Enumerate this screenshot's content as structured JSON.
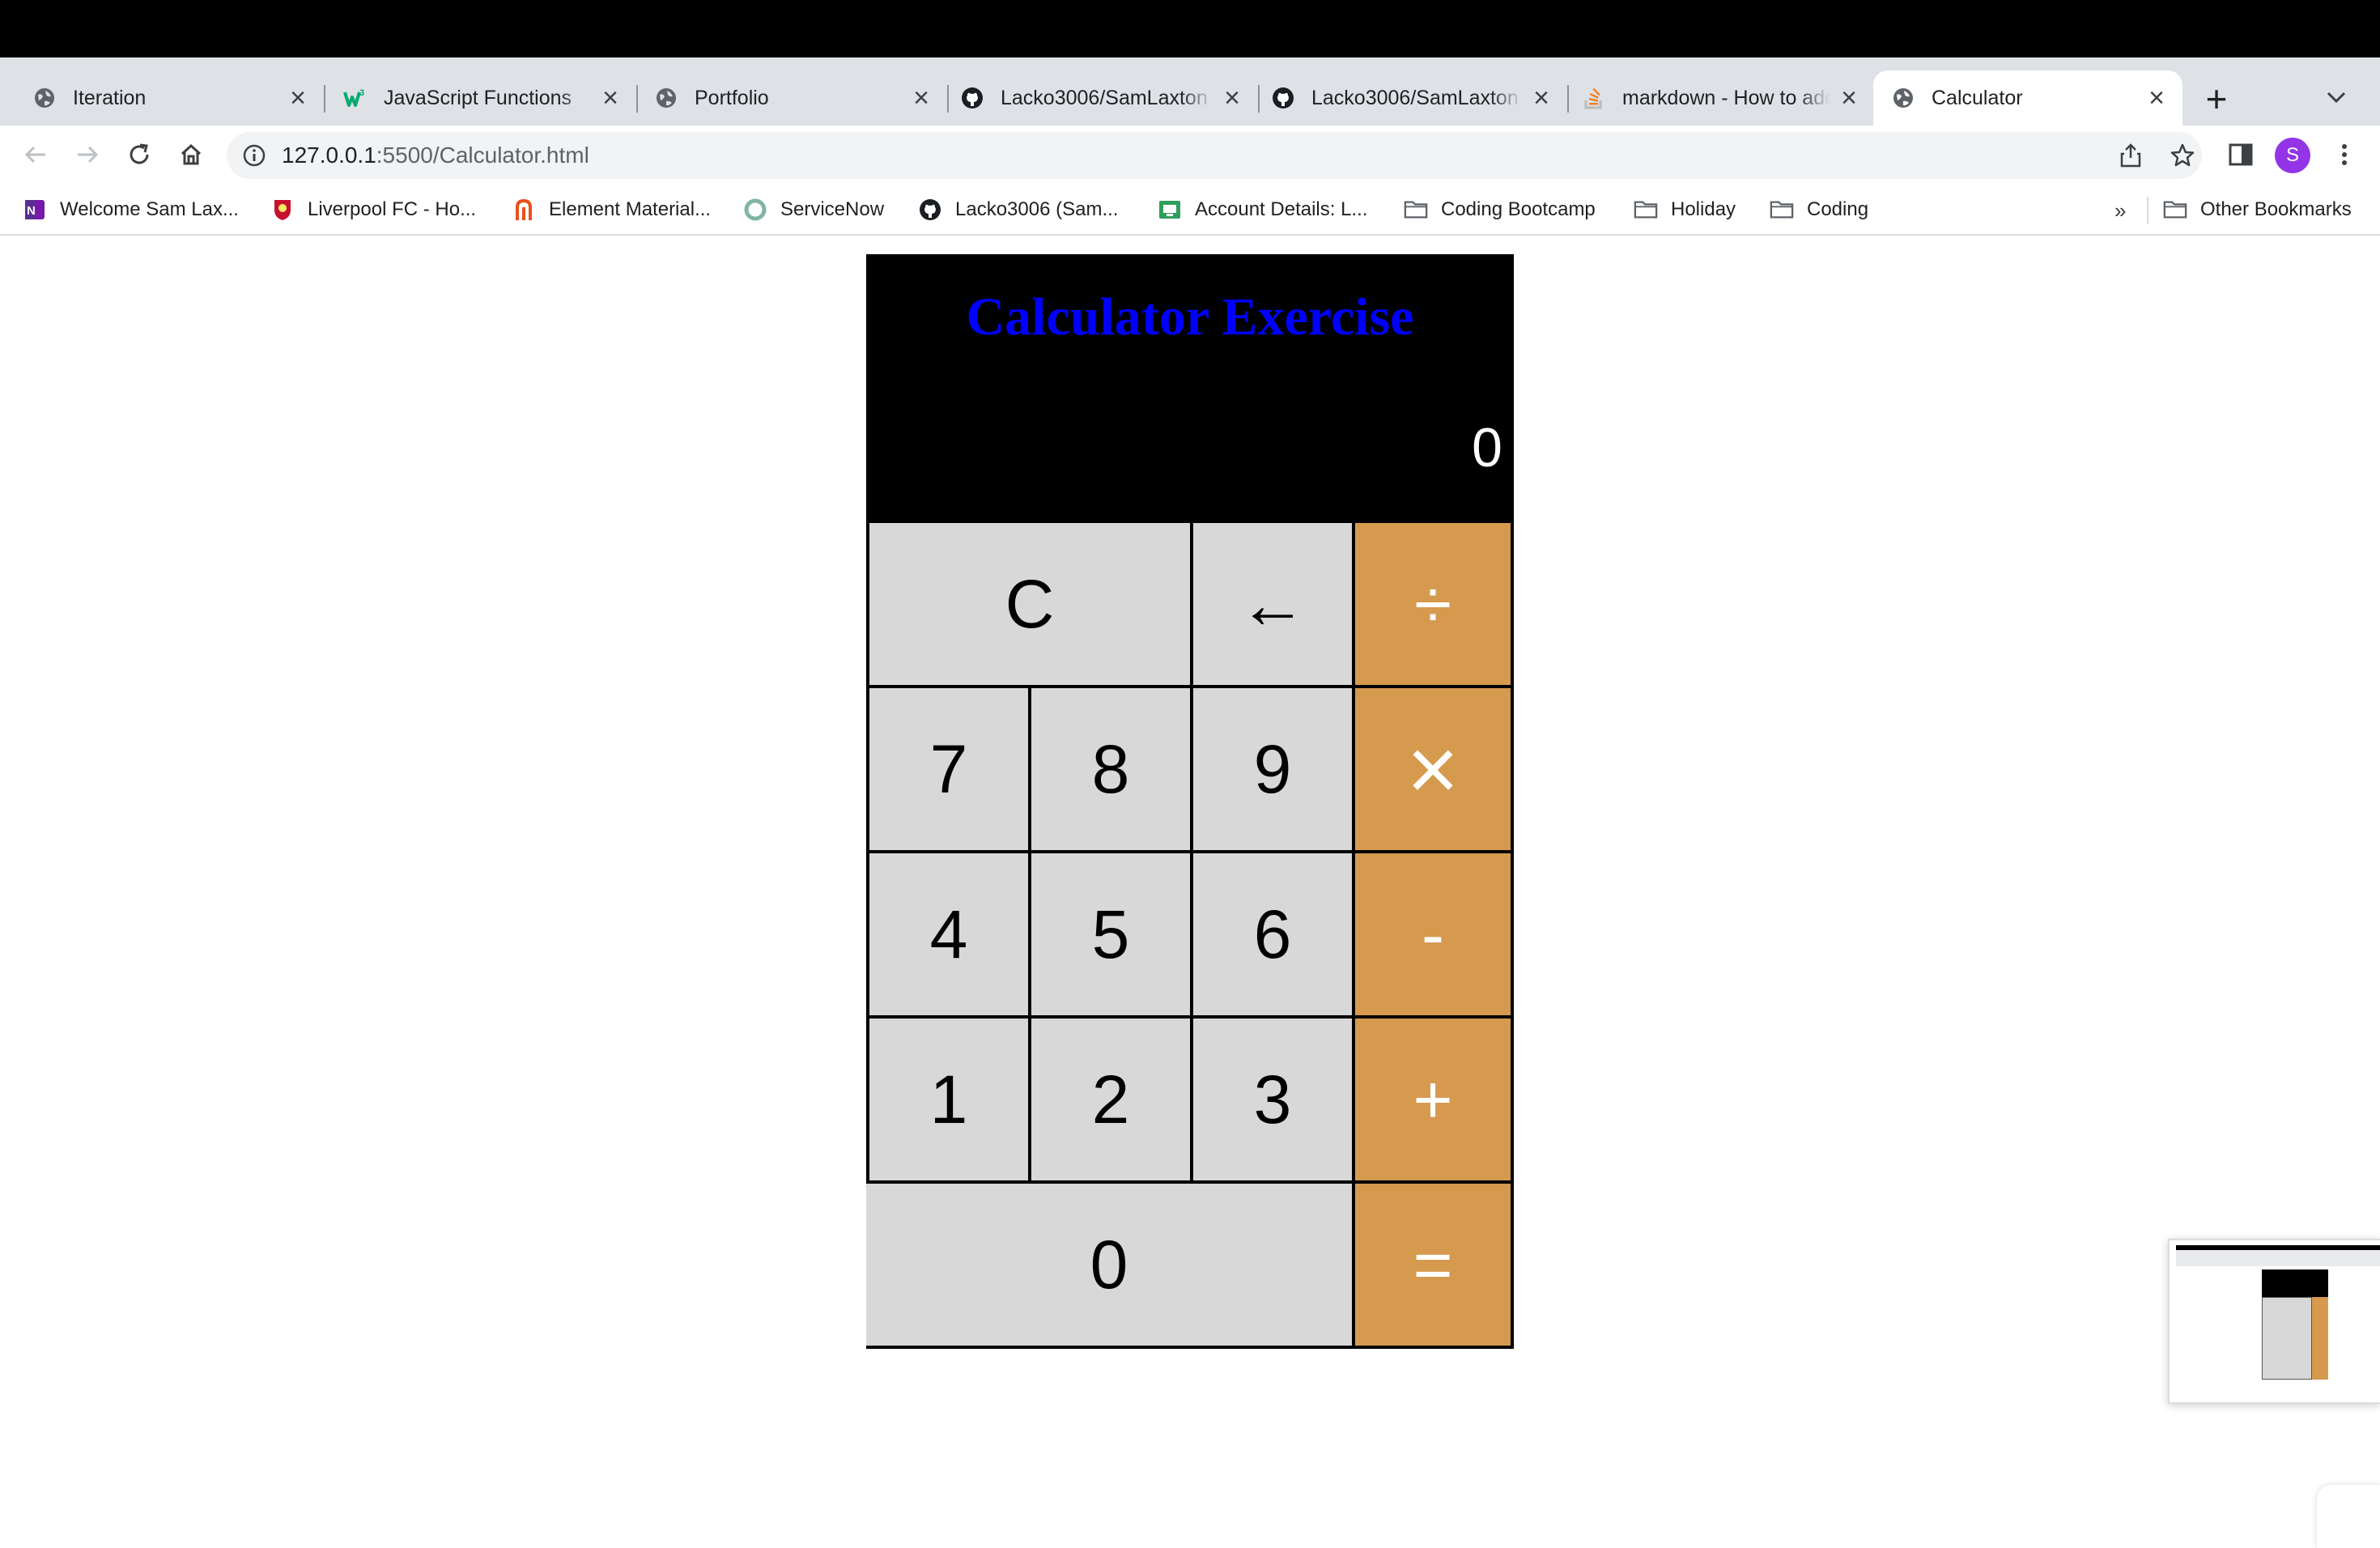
{
  "browser": {
    "tabs": [
      {
        "title": "Iteration",
        "favicon": "globe-icon",
        "active": false
      },
      {
        "title": "JavaScript Functions",
        "favicon": "w3schools-icon",
        "active": false
      },
      {
        "title": "Portfolio",
        "favicon": "globe-icon",
        "active": false
      },
      {
        "title": "Lacko3006/SamLaxton",
        "favicon": "github-icon",
        "active": false
      },
      {
        "title": "Lacko3006/SamLaxton",
        "favicon": "github-icon",
        "active": false
      },
      {
        "title": "markdown - How to add",
        "favicon": "stackoverflow-icon",
        "active": false
      },
      {
        "title": "Calculator",
        "favicon": "globe-icon",
        "active": true
      }
    ],
    "new_tab_label": "+",
    "address": {
      "host": "127.0.0.1",
      "rest": ":5500/Calculator.html"
    },
    "profile_initial": "S",
    "bookmarks": [
      {
        "label": "Welcome Sam Lax...",
        "icon": "onenote-icon"
      },
      {
        "label": "Liverpool FC - Ho...",
        "icon": "liverpool-crest-icon"
      },
      {
        "label": "Element Material...",
        "icon": "element-icon"
      },
      {
        "label": "ServiceNow",
        "icon": "servicenow-icon"
      },
      {
        "label": "Lacko3006 (Sam...",
        "icon": "github-icon"
      },
      {
        "label": "Account Details: L...",
        "icon": "account-icon"
      },
      {
        "label": "Coding Bootcamp",
        "icon": "folder-icon"
      },
      {
        "label": "Holiday",
        "icon": "folder-icon"
      },
      {
        "label": "Coding",
        "icon": "folder-icon"
      }
    ],
    "bookmarks_overflow": "»",
    "other_bookmarks": "Other Bookmarks"
  },
  "calculator": {
    "title": "Calculator Exercise",
    "display": "0",
    "keys": {
      "clear": "C",
      "backspace": "←",
      "divide": "÷",
      "seven": "7",
      "eight": "8",
      "nine": "9",
      "multiply": "×",
      "four": "4",
      "five": "5",
      "six": "6",
      "minus": "-",
      "one": "1",
      "two": "2",
      "three": "3",
      "plus": "+",
      "zero": "0",
      "equals": "="
    },
    "colors": {
      "title": "#0000ff",
      "key": "#d8d8d8",
      "operator": "#d69a4f",
      "header": "#000000"
    }
  }
}
